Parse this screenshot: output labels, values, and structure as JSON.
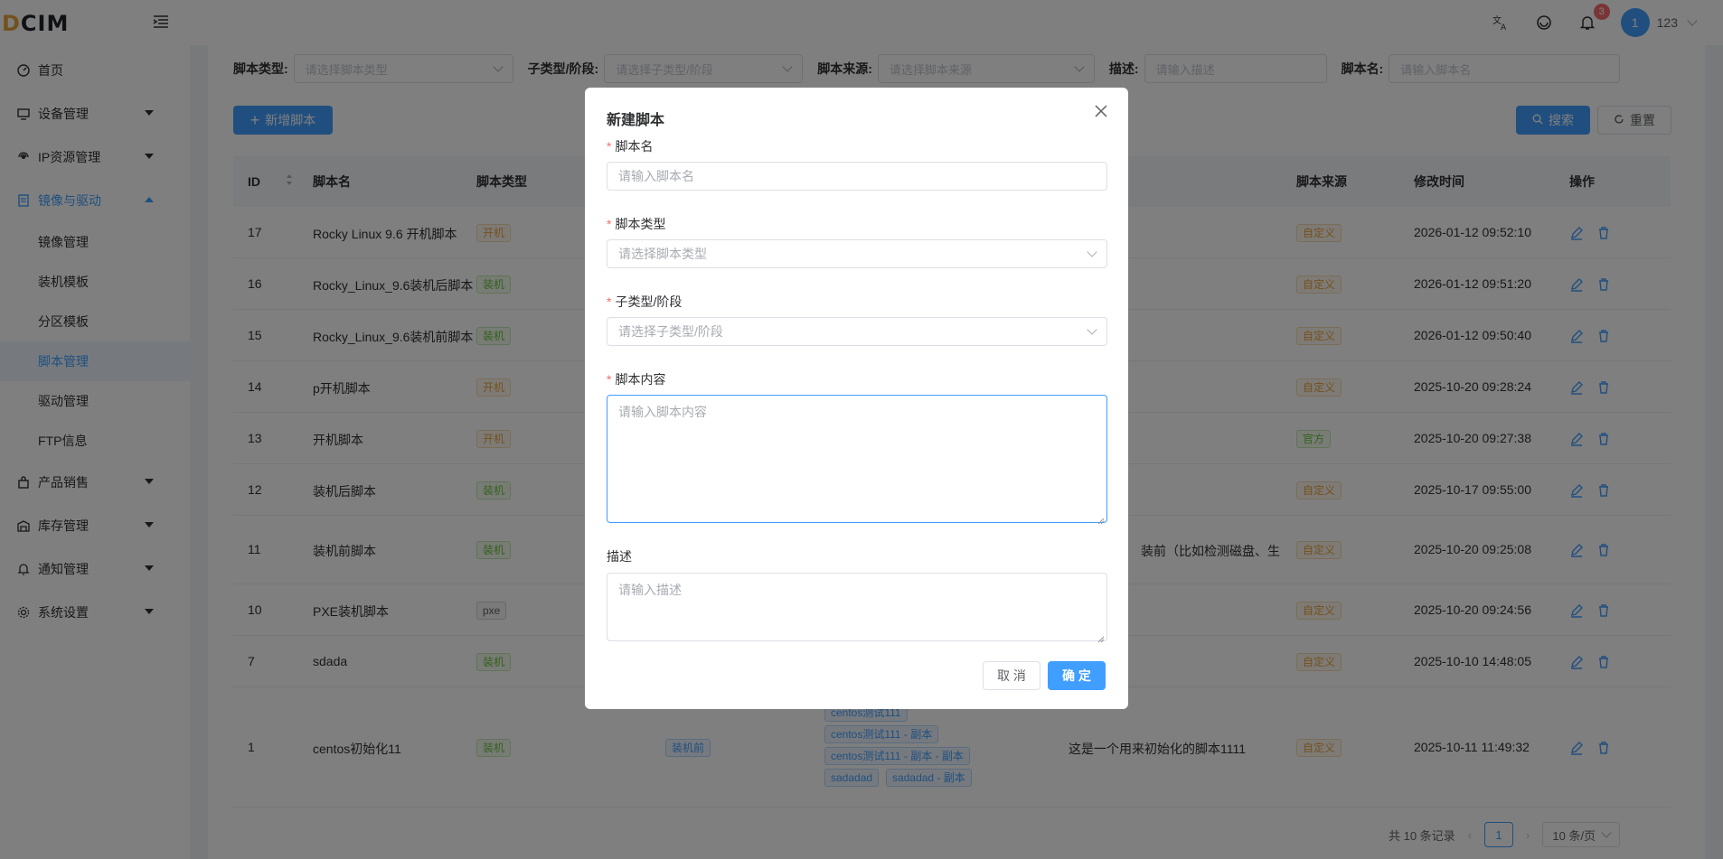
{
  "app": {
    "logo_text": "DCIM"
  },
  "topbar": {
    "notification_count": "3",
    "avatar_initial": "1",
    "username": "123"
  },
  "sidebar": {
    "items": [
      {
        "label": "首页",
        "icon": "dashboard-icon",
        "has_arrow": false
      },
      {
        "label": "设备管理",
        "icon": "monitor-icon",
        "has_arrow": true
      },
      {
        "label": "IP资源管理",
        "icon": "network-icon",
        "has_arrow": true
      },
      {
        "label": "镜像与驱动",
        "icon": "image-icon",
        "has_arrow": true,
        "open": true
      },
      {
        "label": "产品销售",
        "icon": "bag-icon",
        "has_arrow": true
      },
      {
        "label": "库存管理",
        "icon": "warehouse-icon",
        "has_arrow": true
      },
      {
        "label": "通知管理",
        "icon": "bell-icon",
        "has_arrow": true
      },
      {
        "label": "系统设置",
        "icon": "gear-icon",
        "has_arrow": true
      }
    ],
    "subitems": [
      "镜像管理",
      "装机模板",
      "分区模板",
      "脚本管理",
      "驱动管理",
      "FTP信息"
    ],
    "active_subitem": "脚本管理"
  },
  "filters": {
    "type_label": "脚本类型:",
    "type_placeholder": "请选择脚本类型",
    "subtype_label": "子类型/阶段:",
    "subtype_placeholder": "请选择子类型/阶段",
    "source_label": "脚本来源:",
    "source_placeholder": "请选择脚本来源",
    "desc_label": "描述:",
    "desc_placeholder": "请输入描述",
    "name_label": "脚本名:",
    "name_placeholder": "请输入脚本名"
  },
  "toolbar": {
    "add_label": "新增脚本",
    "search_label": "搜索",
    "reset_label": "重置"
  },
  "table": {
    "headers": {
      "id": "ID",
      "name": "脚本名",
      "type": "脚本类型",
      "source": "脚本来源",
      "modified": "修改时间",
      "ops": "操作"
    },
    "rows": [
      {
        "id": "17",
        "name": "Rocky Linux 9.6 开机脚本",
        "type": "开机",
        "type_kind": "warn",
        "source": "自定义",
        "source_kind": "warn",
        "modified": "2026-01-12 09:52:10"
      },
      {
        "id": "16",
        "name": "Rocky_Linux_9.6装机后脚本",
        "type": "装机",
        "type_kind": "ok",
        "source": "自定义",
        "source_kind": "warn",
        "modified": "2026-01-12 09:51:20"
      },
      {
        "id": "15",
        "name": "Rocky_Linux_9.6装机前脚本",
        "type": "装机",
        "type_kind": "ok",
        "source": "自定义",
        "source_kind": "warn",
        "modified": "2026-01-12 09:50:40"
      },
      {
        "id": "14",
        "name": "p开机脚本",
        "type": "开机",
        "type_kind": "warn",
        "source": "自定义",
        "source_kind": "warn",
        "modified": "2025-10-20 09:28:24"
      },
      {
        "id": "13",
        "name": "开机脚本",
        "type": "开机",
        "type_kind": "warn",
        "source": "官方",
        "source_kind": "ok",
        "modified": "2025-10-20 09:27:38"
      },
      {
        "id": "12",
        "name": "装机后脚本",
        "type": "装机",
        "type_kind": "ok",
        "source": "自定义",
        "source_kind": "warn",
        "modified": "2025-10-17 09:55:00"
      },
      {
        "id": "11",
        "name": "装机前脚本",
        "type": "装机",
        "type_kind": "ok",
        "desc": "装前（比如检测磁盘、生",
        "source": "自定义",
        "source_kind": "warn",
        "modified": "2025-10-20 09:25:08"
      },
      {
        "id": "10",
        "name": "PXE装机脚本",
        "type": "pxe",
        "type_kind": "info",
        "source": "自定义",
        "source_kind": "warn",
        "modified": "2025-10-20 09:24:56"
      },
      {
        "id": "7",
        "name": "sdada",
        "type": "装机",
        "type_kind": "ok",
        "source": "自定义",
        "source_kind": "warn",
        "modified": "2025-10-10 14:48:05"
      },
      {
        "id": "1",
        "name": "centos初始化11",
        "type": "装机",
        "type_kind": "ok",
        "subtype": "装机前",
        "templates": [
          "centos测试111",
          "centos测试111 - 副本",
          "centos测试111 - 副本 - 副本",
          "sadadad",
          "sadadad - 副本"
        ],
        "desc": "这是一个用来初始化的脚本1111",
        "source": "自定义",
        "source_kind": "warn",
        "modified": "2025-10-11 11:49:32"
      }
    ]
  },
  "pagination": {
    "total_text": "共 10 条记录",
    "current_page": "1",
    "page_size": "10 条/页"
  },
  "modal": {
    "title": "新建脚本",
    "name_label": "脚本名",
    "name_placeholder": "请输入脚本名",
    "type_label": "脚本类型",
    "type_placeholder": "请选择脚本类型",
    "subtype_label": "子类型/阶段",
    "subtype_placeholder": "请选择子类型/阶段",
    "content_label": "脚本内容",
    "content_placeholder": "请输入脚本内容",
    "desc_label": "描述",
    "desc_placeholder": "请输入描述",
    "cancel_label": "取 消",
    "confirm_label": "确 定"
  },
  "colors": {
    "primary": "#409eff",
    "danger": "#f56c6c",
    "warning": "#e6a23c",
    "success": "#67c23a"
  }
}
